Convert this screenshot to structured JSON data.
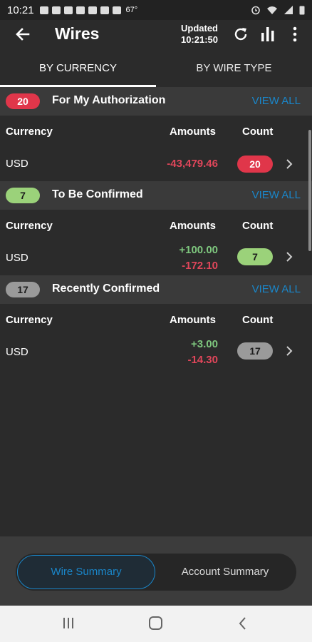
{
  "status_bar": {
    "time": "10:21",
    "temperature": "67°"
  },
  "header": {
    "title": "Wires",
    "updated_label": "Updated",
    "updated_time": "10:21:50"
  },
  "tabs": [
    {
      "label": "BY CURRENCY",
      "active": true
    },
    {
      "label": "BY WIRE TYPE",
      "active": false
    }
  ],
  "columns": {
    "currency": "Currency",
    "amounts": "Amounts",
    "count": "Count"
  },
  "sections": [
    {
      "title": "For My Authorization",
      "badge": "20",
      "badge_color": "#e0364a",
      "view_all": "VIEW ALL",
      "rows": [
        {
          "currency": "USD",
          "positive": "",
          "negative": "-43,479.46",
          "count": "20"
        }
      ]
    },
    {
      "title": "To Be Confirmed",
      "badge": "7",
      "badge_color": "#9bd27a",
      "view_all": "VIEW ALL",
      "rows": [
        {
          "currency": "USD",
          "positive": "+100.00",
          "negative": "-172.10",
          "count": "7"
        }
      ]
    },
    {
      "title": "Recently Confirmed",
      "badge": "17",
      "badge_color": "#9a9a9a",
      "view_all": "VIEW ALL",
      "rows": [
        {
          "currency": "USD",
          "positive": "+3.00",
          "negative": "-14.30",
          "count": "17"
        }
      ]
    }
  ],
  "bottom_toggle": {
    "wire_summary": "Wire Summary",
    "account_summary": "Account Summary",
    "active": "Wire Summary"
  },
  "colors": {
    "accent": "#1a86c9",
    "negative": "#e0465a",
    "positive": "#7ec77e"
  },
  "icons": {
    "back": "arrow-left-icon",
    "refresh": "refresh-icon",
    "chart": "bar-chart-icon",
    "more": "more-vertical-icon"
  }
}
